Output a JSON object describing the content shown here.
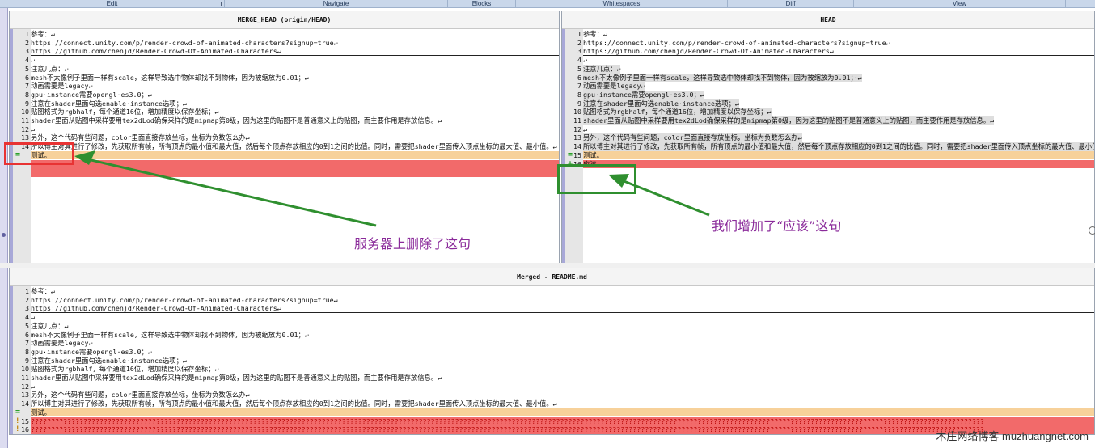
{
  "ribbon": [
    {
      "label": "Edit",
      "launcher": true
    },
    {
      "label": "Navigate",
      "launcher": false
    },
    {
      "label": "Blocks",
      "launcher": false
    },
    {
      "label": "Whitespaces",
      "launcher": false
    },
    {
      "label": "Diff",
      "launcher": false
    },
    {
      "label": "View",
      "launcher": false
    }
  ],
  "panes": {
    "left": {
      "title": "MERGE_HEAD (origin/HEAD)",
      "lines": [
        {
          "num": "1",
          "text": "参考：↵"
        },
        {
          "num": "2",
          "text": "https://connect.unity.com/p/render-crowd-of-animated-characters?signup=true↵"
        },
        {
          "num": "3",
          "text": "https://github.com/chenjd/Render-Crowd-Of-Animated-Characters↵",
          "style": "sep"
        },
        {
          "num": "4",
          "text": "↵"
        },
        {
          "num": "5",
          "text": "注意几点：↵"
        },
        {
          "num": "6",
          "text": "mesh不太像例子里面一样有scale，这样导致选中物体却找不到物体，因为被缩放为0.01；↵"
        },
        {
          "num": "7",
          "text": "动画需要是legacy↵"
        },
        {
          "num": "8",
          "text": "gpu·instance需要opengl·es3.0；↵"
        },
        {
          "num": "9",
          "text": "注意在shader里面勾选enable·instance选项；↵"
        },
        {
          "num": "10",
          "text": "贴图格式为rgbhalf，每个通道16位，增加精度以保存坐标；↵"
        },
        {
          "num": "11",
          "text": "shader里面从贴图中采样要用tex2dLod确保采样的是mipmap第0级，因为这里的贴图不是普通意义上的贴图，而主要作用是存放信息。↵"
        },
        {
          "num": "12",
          "text": "↵"
        },
        {
          "num": "13",
          "text": "另外，这个代码有些问题，color里面直接存放坐标，坐标为负数怎么办↵"
        },
        {
          "num": "14",
          "text": "所以博主对其进行了修改，先获取所有帧，所有顶点的最小值和最大值，然后每个顶点存放相应的0到1之间的比值。同时，需要把shader里面传入顶点坐标的最大值、最小值。↵"
        },
        {
          "num": "",
          "text": "测试。",
          "style": "orange",
          "mark": "="
        },
        {
          "num": "",
          "text": "",
          "style": "red-big"
        }
      ]
    },
    "right": {
      "title": "HEAD",
      "lines": [
        {
          "num": "1",
          "text": "参考：↵"
        },
        {
          "num": "2",
          "text": "https://connect.unity.com/p/render-crowd-of-animated-characters?signup=true↵"
        },
        {
          "num": "3",
          "text": "https://github.com/chenjd/Render-Crowd-Of-Animated-Characters↵",
          "style": "sep"
        },
        {
          "num": "4",
          "text": "↵"
        },
        {
          "num": "5",
          "text": "注意几点：↵",
          "style": "grey"
        },
        {
          "num": "6",
          "text": "mesh不太像例子里面一样有scale，这样导致选中物体却找不到物体，因为被缩放为0.01；·↵",
          "style": "grey"
        },
        {
          "num": "7",
          "text": "动画需要是legacy↵",
          "style": "grey"
        },
        {
          "num": "8",
          "text": "gpu·instance需要opengl·es3.0；↵",
          "style": "grey"
        },
        {
          "num": "9",
          "text": "注意在shader里面勾选enable·instance选项；↵",
          "style": "grey"
        },
        {
          "num": "10",
          "text": "贴图格式为rgbhalf，每个通道16位，增加精度以保存坐标；↵",
          "style": "grey"
        },
        {
          "num": "11",
          "text": "shader里面从贴图中采样要用tex2dLod确保采样的是mipmap第0级，因为这里的贴图不是普通意义上的贴图，而主要作用是存放信息。↵",
          "style": "grey"
        },
        {
          "num": "12",
          "text": "↵"
        },
        {
          "num": "13",
          "text": "另外，这个代码有些问题，color里面直接存放坐标，坐标为负数怎么办↵",
          "style": "grey"
        },
        {
          "num": "14",
          "text": "所以博主对其进行了修改，先获取所有帧，所有顶点的最小值和最大值，然后每个顶点存放相应的0到1之间的比值。同时，需要把shader里面传入顶点坐标的最大值、最小值。↵",
          "style": "grey"
        },
        {
          "num": "15",
          "text": "测试。",
          "style": "orange",
          "mark": "="
        },
        {
          "num": "16",
          "text": "应该。",
          "style": "red",
          "mark": "+"
        }
      ]
    },
    "merged": {
      "title": "Merged - README.md",
      "lines": [
        {
          "num": "1",
          "text": "参考：↵"
        },
        {
          "num": "2",
          "text": "https://connect.unity.com/p/render-crowd-of-animated-characters?signup=true↵"
        },
        {
          "num": "3",
          "text": "https://github.com/chenjd/Render-Crowd-Of-Animated-Characters↵",
          "style": "sep"
        },
        {
          "num": "4",
          "text": "↵"
        },
        {
          "num": "5",
          "text": "注意几点：↵"
        },
        {
          "num": "6",
          "text": "mesh不太像例子里面一样有scale，这样导致选中物体却找不到物体，因为被缩放为0.01；↵"
        },
        {
          "num": "7",
          "text": "动画需要是legacy↵"
        },
        {
          "num": "8",
          "text": "gpu·instance需要opengl·es3.0；↵"
        },
        {
          "num": "9",
          "text": "注意在shader里面勾选enable·instance选项；↵"
        },
        {
          "num": "10",
          "text": "贴图格式为rgbhalf，每个通道16位，增加精度以保存坐标；↵"
        },
        {
          "num": "11",
          "text": "shader里面从贴图中采样要用tex2dLod确保采样的是mipmap第0级，因为这里的贴图不是普通意义上的贴图，而主要作用是存放信息。↵"
        },
        {
          "num": "12",
          "text": "↵"
        },
        {
          "num": "13",
          "text": "另外，这个代码有些问题，color里面直接存放坐标，坐标为负数怎么办↵"
        },
        {
          "num": "14",
          "text": "所以博主对其进行了修改，先获取所有帧，所有顶点的最小值和最大值，然后每个顶点存放相应的0到1之间的比值。同时，需要把shader里面传入顶点坐标的最大值、最小值。↵"
        },
        {
          "num": "",
          "text": "测试。",
          "style": "orange",
          "mark": "="
        },
        {
          "num": "15",
          "text": "????????????????????????????????????????????????????????????????????????????????????????????????????????????????????????????????????????????????????????????????????????????????????????????????????????????????????????????????????????????",
          "style": "red-q",
          "mark": "!"
        },
        {
          "num": "16",
          "text": "????????????????????????????????????????????????????????????????????????????????????????????????????????????????????????????????????????????????????????????????????????????????????????????????????????????????????????????????????????????",
          "style": "red-q",
          "mark": "!"
        }
      ]
    }
  },
  "annotations": {
    "left_note": "服务器上删除了这句",
    "right_note": "我们增加了“应该”这句"
  },
  "watermark": "木庄网络博客 muzhuangnet.com",
  "colors": {
    "conflict_red": "#f26a6a",
    "change_orange": "#f7d19a",
    "annotation_purple": "#8a2a9a"
  }
}
